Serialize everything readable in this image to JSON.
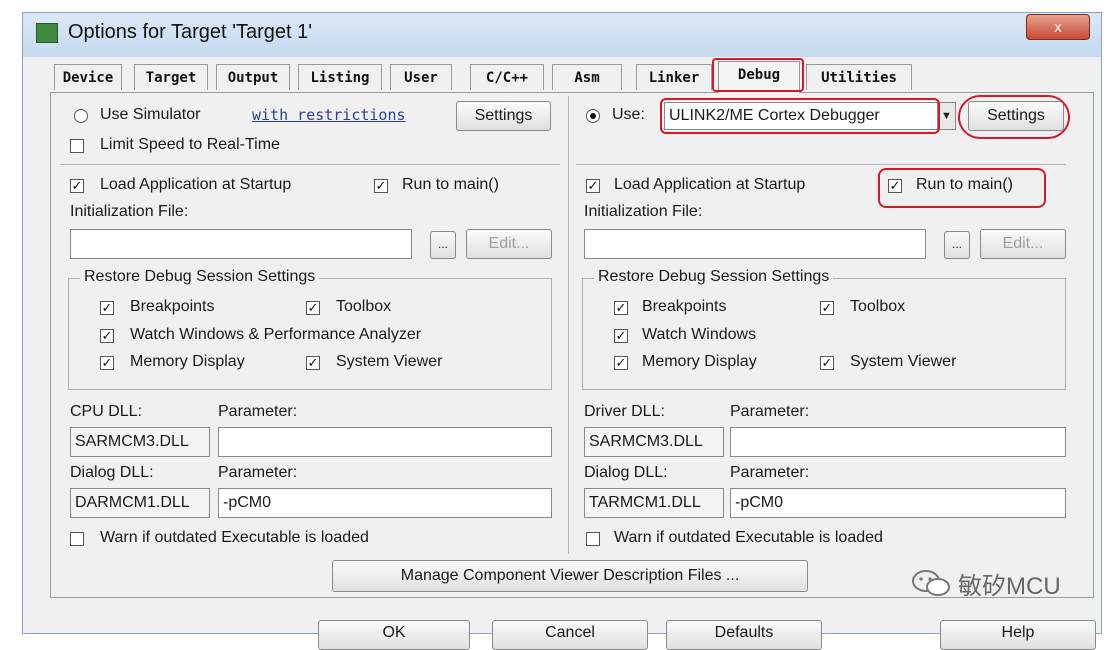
{
  "window": {
    "title": "Options for Target 'Target 1'",
    "close_glyph": "x"
  },
  "tabs": [
    {
      "label": "Device"
    },
    {
      "label": "Target"
    },
    {
      "label": "Output"
    },
    {
      "label": "Listing"
    },
    {
      "label": "User"
    },
    {
      "label": "C/C++"
    },
    {
      "label": "Asm"
    },
    {
      "label": "Linker"
    },
    {
      "label": "Debug",
      "active": true
    },
    {
      "label": "Utilities"
    }
  ],
  "left": {
    "use_simulator": "Use Simulator",
    "restrictions_link": "with restrictions",
    "settings_button": "Settings",
    "limit_speed": "Limit Speed to Real-Time",
    "load_app": "Load Application at Startup",
    "run_to_main": "Run to main()",
    "init_file_label": "Initialization File:",
    "browse_button": "...",
    "edit_button": "Edit...",
    "restore_group": "Restore Debug Session Settings",
    "breakpoints": "Breakpoints",
    "toolbox": "Toolbox",
    "watch_windows": "Watch Windows & Performance Analyzer",
    "memory_display": "Memory Display",
    "system_viewer": "System Viewer",
    "cpu_dll_label": "CPU DLL:",
    "cpu_param_label": "Parameter:",
    "cpu_dll_value": "SARMCM3.DLL",
    "cpu_param_value": "",
    "dialog_dll_label": "Dialog DLL:",
    "dialog_param_label": "Parameter:",
    "dialog_dll_value": "DARMCM1.DLL",
    "dialog_param_value": "-pCM0",
    "warn_outdated": "Warn if outdated Executable is loaded"
  },
  "right": {
    "use": "Use:",
    "debugger_value": "ULINK2/ME Cortex Debugger",
    "settings_button": "Settings",
    "load_app": "Load Application at Startup",
    "run_to_main": "Run to main()",
    "init_file_label": "Initialization File:",
    "browse_button": "...",
    "edit_button": "Edit...",
    "restore_group": "Restore Debug Session Settings",
    "breakpoints": "Breakpoints",
    "toolbox": "Toolbox",
    "watch_windows": "Watch Windows",
    "memory_display": "Memory Display",
    "system_viewer": "System Viewer",
    "driver_dll_label": "Driver DLL:",
    "driver_param_label": "Parameter:",
    "driver_dll_value": "SARMCM3.DLL",
    "driver_param_value": "",
    "dialog_dll_label": "Dialog DLL:",
    "dialog_param_label": "Parameter:",
    "dialog_dll_value": "TARMCM1.DLL",
    "dialog_param_value": "-pCM0",
    "warn_outdated": "Warn if outdated Executable is loaded"
  },
  "manage_button": "Manage Component Viewer Description Files ...",
  "bottom_buttons": [
    "OK",
    "Cancel",
    "Defaults",
    "Help"
  ],
  "watermark": "敏矽MCU",
  "colors": {
    "annotation": "#d4192b",
    "link": "#2a3fa0",
    "title_bar": "#c6d9f0"
  }
}
